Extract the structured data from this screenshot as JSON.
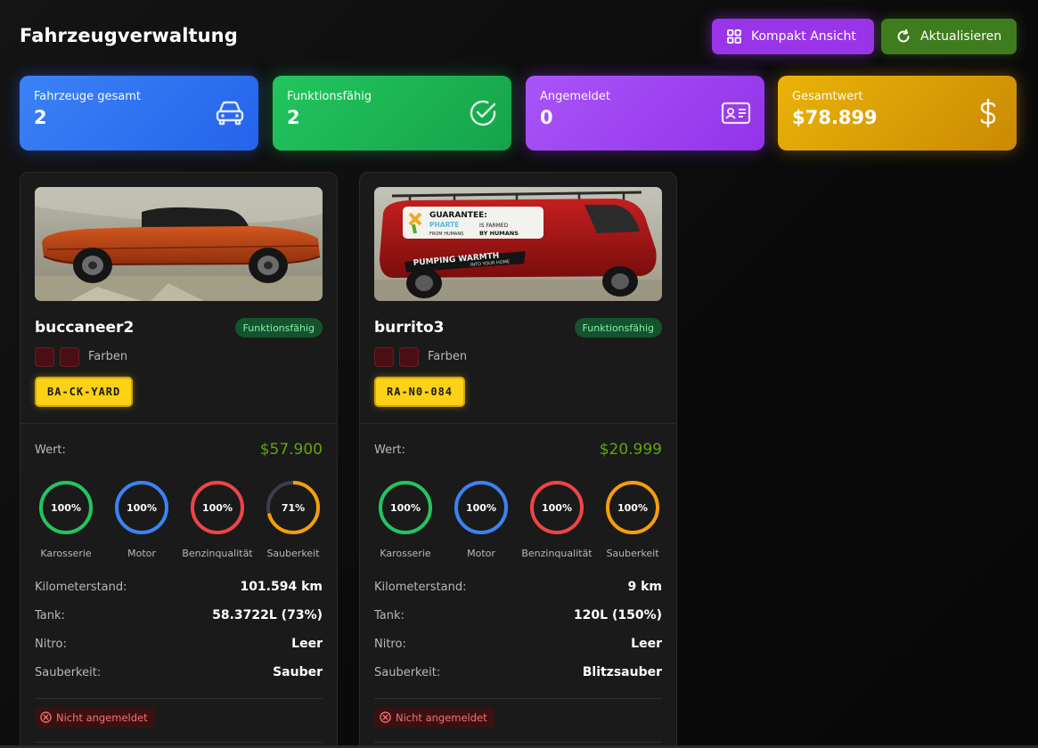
{
  "header": {
    "title": "Fahrzeugverwaltung",
    "compact_label": "Kompakt Ansicht",
    "refresh_label": "Aktualisieren"
  },
  "stats": [
    {
      "label": "Fahrzeuge gesamt",
      "value": "2",
      "icon": "car-icon",
      "color": "#2563eb"
    },
    {
      "label": "Funktionsfähig",
      "value": "2",
      "icon": "check-circle-icon",
      "color": "#16a34a"
    },
    {
      "label": "Angemeldet",
      "value": "0",
      "icon": "id-card-icon",
      "color": "#9333ea"
    },
    {
      "label": "Gesamtwert",
      "value": "$78.899",
      "icon": "dollar-icon",
      "color": "#ca8a04"
    }
  ],
  "vehicles": [
    {
      "name": "buccaneer2",
      "status": "Funktionsfähig",
      "colors_label": "Farben",
      "plate": "BA-CK-YARD",
      "value_label": "Wert:",
      "value": "$57.900",
      "gauges": [
        {
          "label": "Karosserie",
          "percent": 100,
          "text": "100%",
          "color": "#22c55e"
        },
        {
          "label": "Motor",
          "percent": 100,
          "text": "100%",
          "color": "#3b82f6"
        },
        {
          "label": "Benzinqualität",
          "percent": 100,
          "text": "100%",
          "color": "#ef4444"
        },
        {
          "label": "Sauberkeit",
          "percent": 71,
          "text": "71%",
          "color": "#f59e0b"
        }
      ],
      "details": [
        {
          "label": "Kilometerstand:",
          "value": "101.594 km"
        },
        {
          "label": "Tank:",
          "value": "58.3722L (73%)"
        },
        {
          "label": "Nitro:",
          "value": "Leer"
        },
        {
          "label": "Sauberkeit:",
          "value": "Sauber"
        }
      ],
      "registration": "Nicht angemeldet"
    },
    {
      "name": "burrito3",
      "status": "Funktionsfähig",
      "colors_label": "Farben",
      "plate": "RA-N0-084",
      "value_label": "Wert:",
      "value": "$20.999",
      "gauges": [
        {
          "label": "Karosserie",
          "percent": 100,
          "text": "100%",
          "color": "#22c55e"
        },
        {
          "label": "Motor",
          "percent": 100,
          "text": "100%",
          "color": "#3b82f6"
        },
        {
          "label": "Benzinqualität",
          "percent": 100,
          "text": "100%",
          "color": "#ef4444"
        },
        {
          "label": "Sauberkeit",
          "percent": 100,
          "text": "100%",
          "color": "#f59e0b"
        }
      ],
      "details": [
        {
          "label": "Kilometerstand:",
          "value": "9 km"
        },
        {
          "label": "Tank:",
          "value": "120L (150%)"
        },
        {
          "label": "Nitro:",
          "value": "Leer"
        },
        {
          "label": "Sauberkeit:",
          "value": "Blitzsauber"
        }
      ],
      "registration": "Nicht angemeldet",
      "van_text": {
        "line1": "GUARANTEE:",
        "line2a": "PHARTE",
        "line2b": "IS FARMED",
        "line3a": "FROM HUMANS",
        "line3b": "BY HUMANS",
        "slogan1": "PUMPING WARMTH",
        "slogan2": "INTO YOUR HOME"
      }
    }
  ]
}
